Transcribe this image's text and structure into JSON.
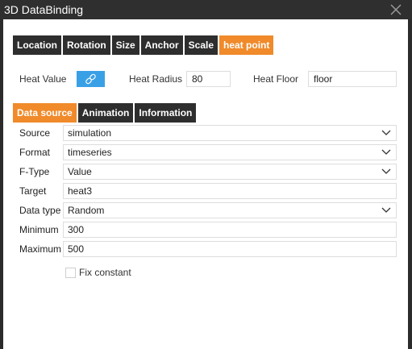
{
  "window": {
    "title": "3D DataBinding"
  },
  "top_tabs": [
    {
      "label": "Location"
    },
    {
      "label": "Rotation"
    },
    {
      "label": "Size"
    },
    {
      "label": "Anchor"
    },
    {
      "label": "Scale"
    },
    {
      "label": "heat point",
      "active": true
    }
  ],
  "heat": {
    "value_label": "Heat Value",
    "radius_label": "Heat Radius",
    "radius_value": "80",
    "floor_label": "Heat Floor",
    "floor_value": "floor"
  },
  "sub_tabs": [
    {
      "label": "Data source",
      "active": true
    },
    {
      "label": "Animation"
    },
    {
      "label": "Information"
    }
  ],
  "form": {
    "source_label": "Source",
    "source_value": "simulation",
    "format_label": "Format",
    "format_value": "timeseries",
    "ftype_label": "F-Type",
    "ftype_value": "Value",
    "target_label": "Target",
    "target_value": "heat3",
    "datatype_label": "Data type",
    "datatype_value": "Random",
    "minimum_label": "Minimum",
    "minimum_value": "300",
    "maximum_label": "Maximum",
    "maximum_value": "500",
    "fix_constant_label": "Fix constant"
  },
  "colors": {
    "accent": "#f08a2a",
    "tab_bg": "#2e2e2e",
    "link_button": "#3aa0e6",
    "titlebar": "#2f2f2f"
  }
}
